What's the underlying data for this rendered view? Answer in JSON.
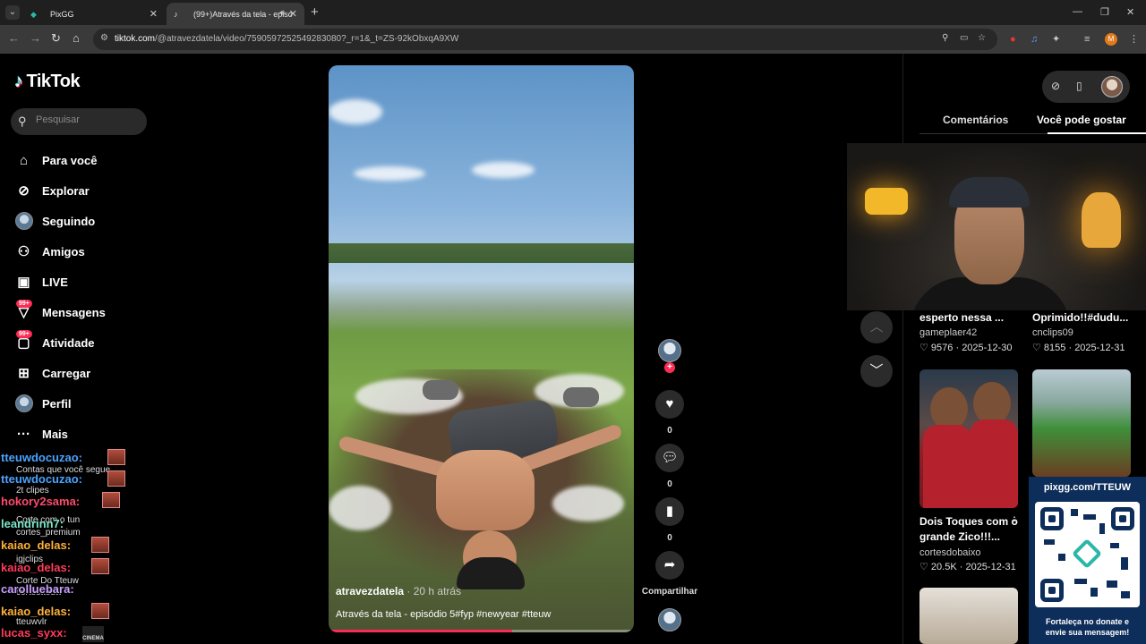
{
  "browser": {
    "tabs": [
      {
        "title": "PixGG"
      },
      {
        "title": "(99+)Através da tela - episó"
      }
    ],
    "url_host": "tiktok.com",
    "url_path": "/@atravezdatela/video/7590597252549283080?_r=1&_t=ZS-92kObxqA9XW",
    "profile_initial": "M"
  },
  "sidebar": {
    "logo": "TikTok",
    "search_placeholder": "Pesquisar",
    "items": [
      {
        "label": "Para você",
        "icon": "home-icon"
      },
      {
        "label": "Explorar",
        "icon": "compass-icon"
      },
      {
        "label": "Seguindo",
        "icon": "following-avatar-icon"
      },
      {
        "label": "Amigos",
        "icon": "friends-icon"
      },
      {
        "label": "LIVE",
        "icon": "live-tv-icon"
      },
      {
        "label": "Mensagens",
        "icon": "inbox-icon",
        "badge": "99+"
      },
      {
        "label": "Atividade",
        "icon": "activity-icon",
        "badge": "99+"
      },
      {
        "label": "Carregar",
        "icon": "upload-icon"
      },
      {
        "label": "Perfil",
        "icon": "profile-avatar-icon"
      },
      {
        "label": "Mais",
        "icon": "more-dots-icon"
      }
    ]
  },
  "chat": [
    {
      "user": "tteuwdocuzao:",
      "behind": "Contas que você segue"
    },
    {
      "user": "tteuwdocuzao:",
      "behind": "2t clipes"
    },
    {
      "user": "hokory2sama:",
      "behind": "Corte com o tun"
    },
    {
      "user": "leandrinn7:",
      "behind": "cortes_premium"
    },
    {
      "user": "kaiao_delas:",
      "behind": "igjclips"
    },
    {
      "user": "kaiao_delas:",
      "behind": "Corte Do Tteuw"
    },
    {
      "user": "carolluebara:",
      "behind": "cortestteuw"
    },
    {
      "user": "kaiao_delas:",
      "behind": "tteuwvlr"
    },
    {
      "user": "lucas_syxx:",
      "behind": ""
    }
  ],
  "chat_emote_label": "CINEMA",
  "video": {
    "username": "atravezdatela",
    "time_ago": "· 20 h atrás",
    "description": "Através da tela - episódio 5#fyp #newyear #tteuw",
    "progress": 0.6
  },
  "actions": {
    "like_count": "0",
    "comment_count": "0",
    "save_count": "0",
    "share_label": "Compartilhar"
  },
  "right_panel": {
    "tabs": [
      "Comentários",
      "Você pode gostar"
    ],
    "active_tab": "Você pode gostar",
    "cards": [
      {
        "title": "esperto nessa ...",
        "author": "gameplaer42",
        "likes": "9576",
        "date": "2025-12-30"
      },
      {
        "title": "Oprimido!!#dudu...",
        "author": "cnclips09",
        "likes": "8155",
        "date": "2025-12-31"
      },
      {
        "title": "Dois Toques com o",
        "title2": "grande Zico!!!...",
        "author": "cortesdobaixo",
        "likes": "20.5K",
        "date": "2025-12-31"
      }
    ]
  },
  "donation": {
    "url": "pixgg.com/TTEUW",
    "message_line1": "Fortaleça no donate e",
    "message_line2": "envie sua mensagem!"
  },
  "colors": {
    "accent": "#fe2c55",
    "background": "#000000",
    "donate_bg": "#0d2d5a"
  }
}
